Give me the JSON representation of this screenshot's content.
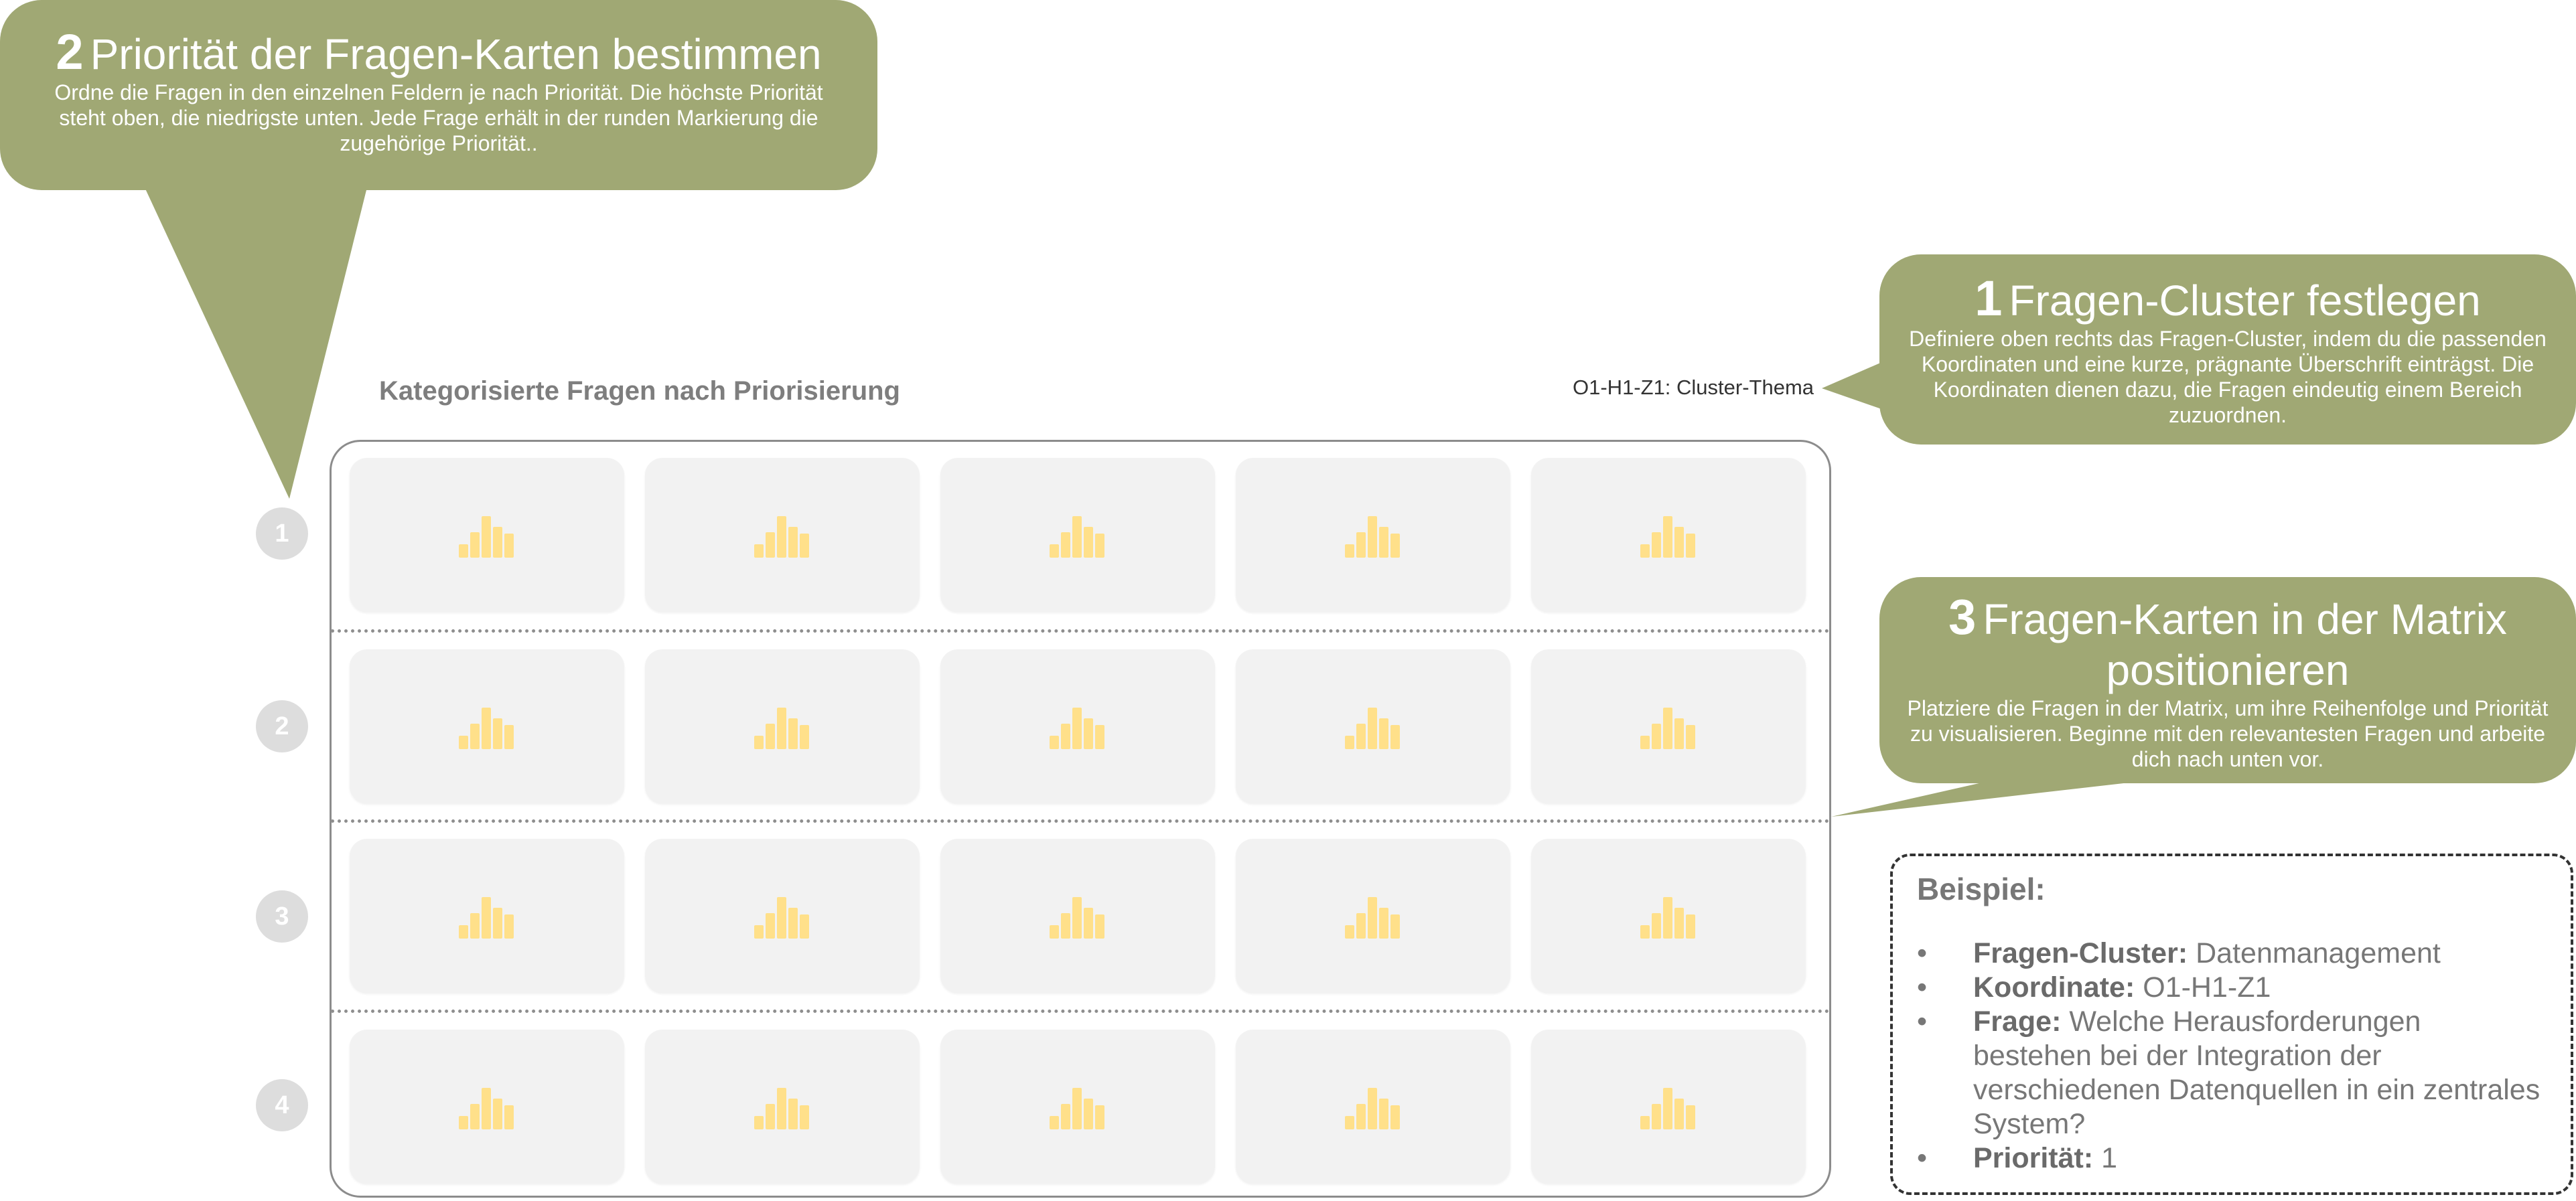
{
  "steps": [
    {
      "number": "1",
      "title": "Fragen-Cluster festlegen",
      "body": "Definiere oben rechts das Fragen-Cluster, indem du die passenden Koordinaten und eine kurze, prägnante Überschrift einträgst. Die Koordinaten dienen dazu, die Fragen eindeutig einem Bereich zuzuordnen."
    },
    {
      "number": "2",
      "title": "Priorität der Fragen-Karten bestimmen",
      "body": "Ordne die Fragen in den einzelnen Feldern je nach Priorität. Die höchste Priorität steht oben, die niedrigste unten. Jede Frage erhält in der runden Markierung die zugehörige Priorität.."
    },
    {
      "number": "3",
      "title": "Fragen-Karten in der Matrix positionieren",
      "body": "Platziere die Fragen in der Matrix, um ihre Reihenfolge und Priorität zu visualisieren. Beginne mit den relevantesten Fragen und arbeite dich nach unten vor."
    }
  ],
  "matrix": {
    "heading": "Kategorisierte Fragen nach Priorisierung",
    "cluster_label": "O1-H1-Z1: Cluster-Thema",
    "rows": [
      "1",
      "2",
      "3",
      "4"
    ],
    "cards_per_row": 5,
    "card_icon": "bar-chart-placeholder-icon"
  },
  "example": {
    "title": "Beispiel:",
    "items": [
      {
        "label": "Fragen-Cluster:",
        "value": "Datenmanagement"
      },
      {
        "label": "Koordinate:",
        "value": "O1-H1-Z1"
      },
      {
        "label": "Frage:",
        "value": "Welche Herausforderungen bestehen bei der Integration der verschiedenen Datenquellen in ein zentrales System?"
      },
      {
        "label": "Priorität:",
        "value": "1"
      }
    ]
  },
  "colors": {
    "bubble": "#a0a874",
    "card": "#f2f2f2",
    "icon": "#ffe08a",
    "badge": "#dddddd"
  }
}
